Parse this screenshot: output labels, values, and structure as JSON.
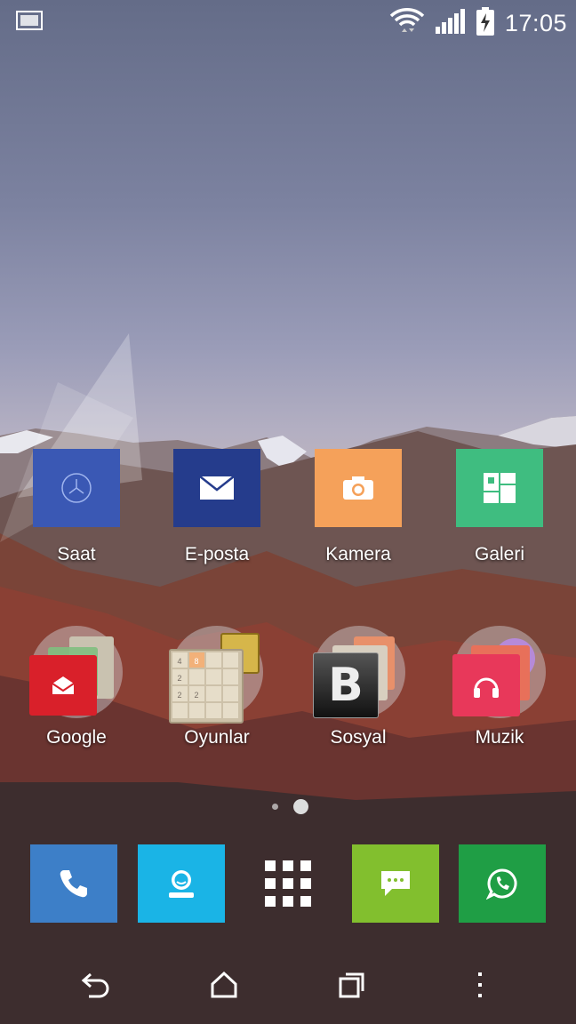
{
  "status_bar": {
    "time": "17:05",
    "icons": [
      "screenshot-notification-icon",
      "wifi-icon",
      "signal-icon",
      "battery-charging-icon"
    ]
  },
  "home": {
    "row1": [
      {
        "label": "Saat",
        "icon": "clock-icon",
        "color": "#3a58b4"
      },
      {
        "label": "E-posta",
        "icon": "mail-icon",
        "color": "#253c8c"
      },
      {
        "label": "Kamera",
        "icon": "camera-icon",
        "color": "#f5a15a"
      },
      {
        "label": "Galeri",
        "icon": "gallery-icon",
        "color": "#3fbd80"
      }
    ],
    "row2": [
      {
        "label": "Google",
        "icon": "gmail-folder-icon"
      },
      {
        "label": "Oyunlar",
        "icon": "2048-game-folder-icon"
      },
      {
        "label": "Sosyal",
        "icon": "social-folder-icon"
      },
      {
        "label": "Muzik",
        "icon": "music-folder-icon"
      }
    ],
    "page_indicator": {
      "pages": 2,
      "active": 2
    },
    "game_tiles": [
      "4",
      "8",
      "2",
      "2",
      "2"
    ],
    "social_letter": "B"
  },
  "dock": [
    {
      "icon": "phone-icon",
      "color": "#3d7fc8"
    },
    {
      "icon": "contacts-icon",
      "color": "#1ab4e6"
    },
    {
      "icon": "app-drawer-icon",
      "color": "transparent"
    },
    {
      "icon": "messages-icon",
      "color": "#82bf2e"
    },
    {
      "icon": "whatsapp-icon",
      "color": "#1f9e45"
    }
  ],
  "nav": [
    "back-icon",
    "home-icon",
    "recents-icon",
    "menu-icon"
  ]
}
